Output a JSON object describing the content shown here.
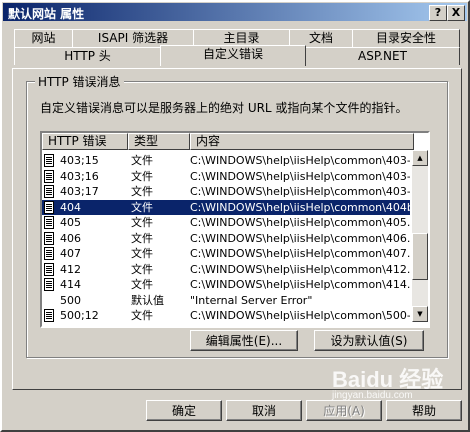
{
  "window": {
    "title": "默认网站 属性",
    "help_btn": "?",
    "close_btn": "X"
  },
  "tabs_row1": [
    "网站",
    "ISAPI 筛选器",
    "主目录",
    "文档",
    "目录安全性"
  ],
  "tabs_row2": [
    "HTTP 头",
    "自定义错误",
    "ASP.NET"
  ],
  "active_tab": "自定义错误",
  "group": {
    "label": "HTTP 错误消息",
    "description": "自定义错误消息可以是服务器上的绝对 URL 或指向某个文件的指针。"
  },
  "list": {
    "columns": [
      "HTTP 错误",
      "类型",
      "内容"
    ],
    "rows": [
      {
        "code": "403;15",
        "type": "文件",
        "content": "C:\\WINDOWS\\help\\iisHelp\\common\\403-...",
        "icon": "document-icon"
      },
      {
        "code": "403;16",
        "type": "文件",
        "content": "C:\\WINDOWS\\help\\iisHelp\\common\\403-...",
        "icon": "document-icon"
      },
      {
        "code": "403;17",
        "type": "文件",
        "content": "C:\\WINDOWS\\help\\iisHelp\\common\\403-...",
        "icon": "document-icon"
      },
      {
        "code": "404",
        "type": "文件",
        "content": "C:\\WINDOWS\\help\\iisHelp\\common\\404b.h",
        "icon": "document-icon",
        "selected": true
      },
      {
        "code": "405",
        "type": "文件",
        "content": "C:\\WINDOWS\\help\\iisHelp\\common\\405.ht",
        "icon": "document-icon"
      },
      {
        "code": "406",
        "type": "文件",
        "content": "C:\\WINDOWS\\help\\iisHelp\\common\\406.ht",
        "icon": "document-icon"
      },
      {
        "code": "407",
        "type": "文件",
        "content": "C:\\WINDOWS\\help\\iisHelp\\common\\407.ht",
        "icon": "document-icon"
      },
      {
        "code": "412",
        "type": "文件",
        "content": "C:\\WINDOWS\\help\\iisHelp\\common\\412.ht",
        "icon": "document-icon"
      },
      {
        "code": "414",
        "type": "文件",
        "content": "C:\\WINDOWS\\help\\iisHelp\\common\\414.ht",
        "icon": "document-icon"
      },
      {
        "code": "500",
        "type": "默认值",
        "content": "\"Internal Server Error\"",
        "icon": ""
      },
      {
        "code": "500;12",
        "type": "文件",
        "content": "C:\\WINDOWS\\help\\iisHelp\\common\\500-...",
        "icon": "document-icon"
      }
    ]
  },
  "buttons": {
    "edit": "编辑属性(E)...",
    "set_default": "设为默认值(S)",
    "ok": "确定",
    "cancel": "取消",
    "apply": "应用(A)",
    "help": "帮助"
  },
  "watermark": {
    "text": "Baidu 经验",
    "sub": "jingyan.baidu.com"
  },
  "colors": {
    "titlebar": "#0a246a",
    "selection": "#0a246a",
    "face": "#d4d0c8"
  }
}
